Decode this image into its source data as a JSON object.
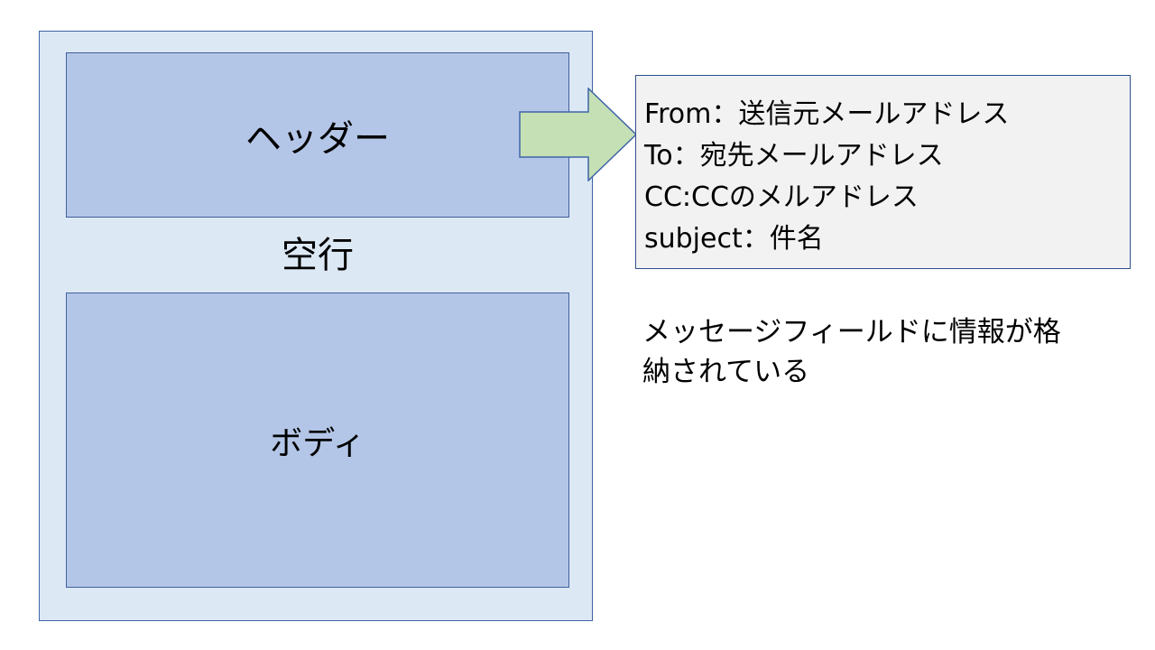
{
  "diagram": {
    "header_label": "ヘッダー",
    "blank_line_label": "空行",
    "body_label": "ボディ",
    "header_fields": [
      "From：送信元メールアドレス",
      "To：宛先メールアドレス",
      "CC:CCのメルアドレス",
      "subject：件名"
    ],
    "note_line1": "メッセージフィールドに情報が格",
    "note_line2": "納されている"
  },
  "colors": {
    "frame_fill": "#dde8f5",
    "section_fill": "#b4c6e7",
    "arrow_fill": "#c5e0b4",
    "fields_fill": "#f2f2f2"
  },
  "icons": {
    "arrow": "right-arrow-icon"
  }
}
